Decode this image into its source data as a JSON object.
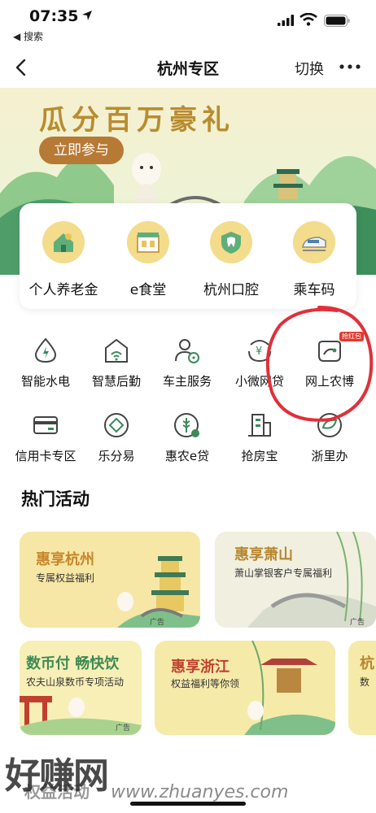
{
  "status_bar": {
    "time": "07:35",
    "back_app": "◀ 搜索"
  },
  "nav": {
    "title": "杭州专区",
    "switch_label": "切换"
  },
  "banner": {
    "title": "瓜分百万豪礼",
    "button": "立即参与"
  },
  "quick_services": [
    {
      "label": "个人养老金",
      "icon": "piggy-house-icon"
    },
    {
      "label": "e食堂",
      "icon": "canteen-icon"
    },
    {
      "label": "杭州口腔",
      "icon": "tooth-icon"
    },
    {
      "label": "乘车码",
      "icon": "train-icon"
    }
  ],
  "services": [
    {
      "label": "智能水电",
      "icon": "water-drop-icon"
    },
    {
      "label": "智慧后勤",
      "icon": "smart-house-icon"
    },
    {
      "label": "车主服务",
      "icon": "driver-icon"
    },
    {
      "label": "小微网贷",
      "icon": "loan-icon"
    },
    {
      "label": "网上农博",
      "icon": "agri-icon",
      "badge": "抢红包"
    },
    {
      "label": "信用卡专区",
      "icon": "credit-card-icon"
    },
    {
      "label": "乐分易",
      "icon": "diamond-icon"
    },
    {
      "label": "惠农e贷",
      "icon": "wheat-icon"
    },
    {
      "label": "抢房宝",
      "icon": "building-icon"
    },
    {
      "label": "浙里办",
      "icon": "leaf-icon"
    }
  ],
  "hot": {
    "title": "热门活动",
    "cards": [
      {
        "title": "惠享杭州",
        "subtitle": "专属权益福利",
        "ad": "广告"
      },
      {
        "title": "惠享萧山",
        "subtitle": "萧山掌银客户专属福利",
        "ad": "广告"
      },
      {
        "title": "数币付 畅快饮",
        "subtitle": "农夫山泉数币专项活动",
        "ad": "广告"
      },
      {
        "title": "惠享浙江",
        "subtitle": "权益福利等你领",
        "ad": ""
      },
      {
        "title": "杭",
        "subtitle": "数",
        "ad": ""
      }
    ]
  },
  "bottom_partial": "权益活动",
  "watermark": {
    "logo": "好赚网",
    "url": "www.zhuanyes.com"
  },
  "colors": {
    "accent_gold": "#b77a36",
    "icon_green": "#3a8a5c",
    "annotation_red": "#e0303a"
  }
}
